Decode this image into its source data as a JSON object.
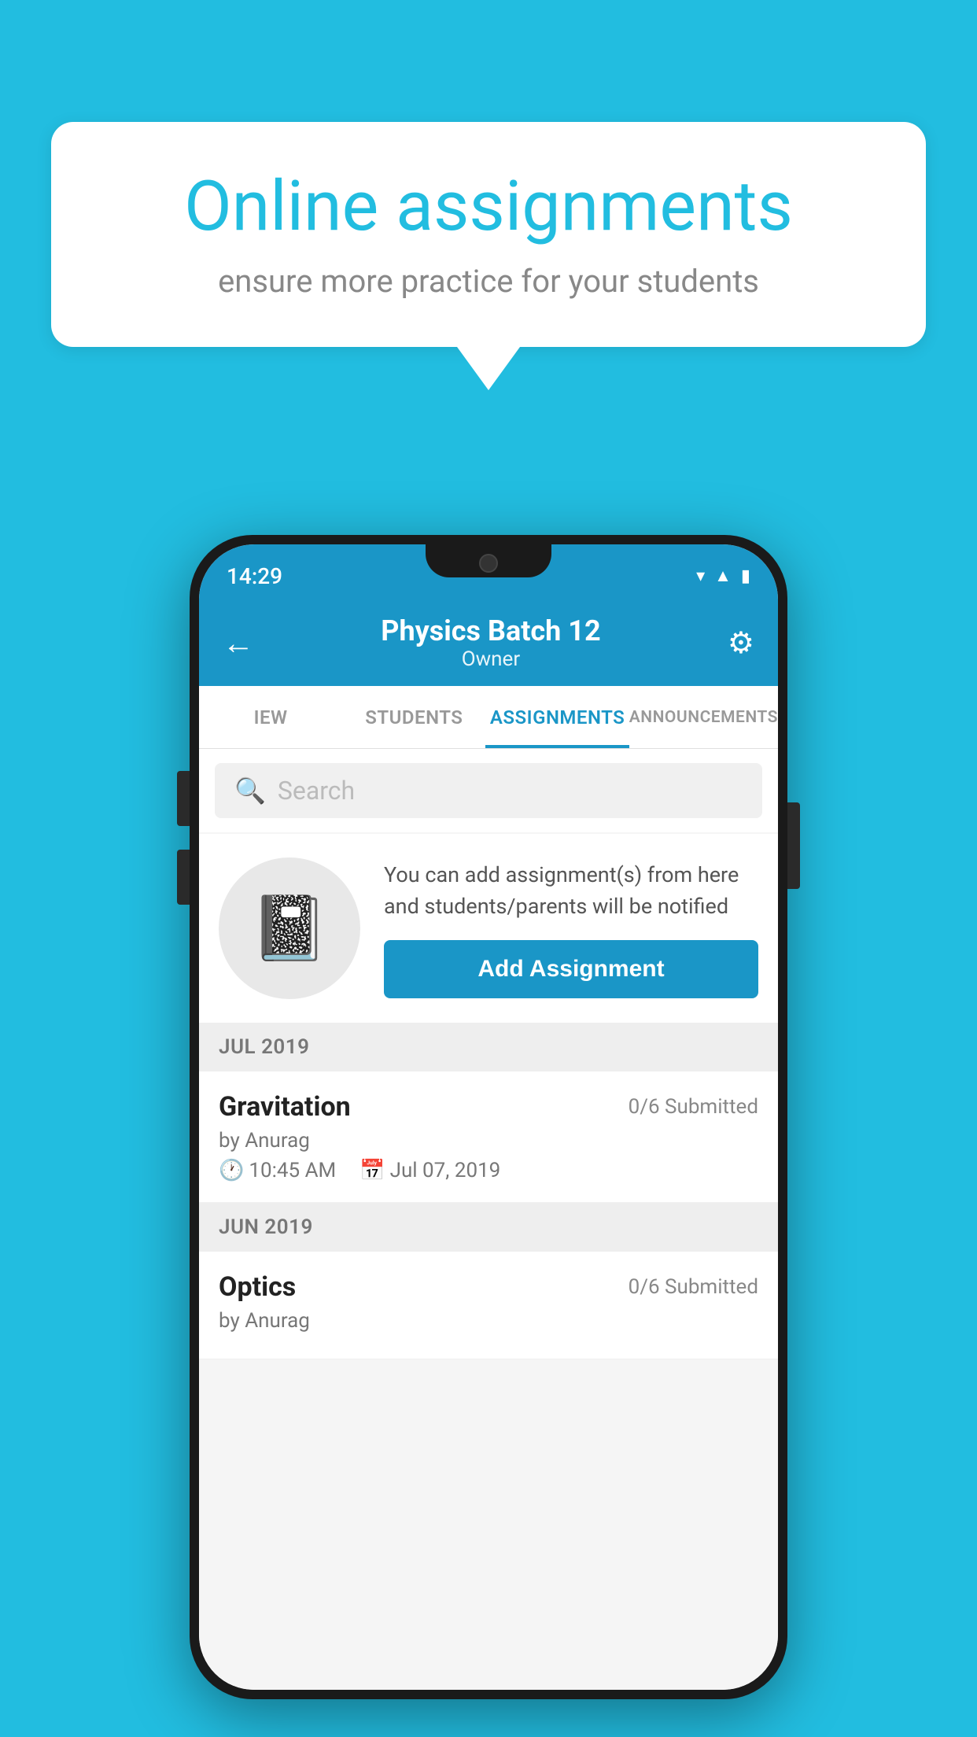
{
  "background_color": "#22bde0",
  "speech_bubble": {
    "title": "Online assignments",
    "subtitle": "ensure more practice for your students"
  },
  "phone": {
    "status_bar": {
      "time": "14:29",
      "icons": [
        "wifi",
        "signal",
        "battery"
      ]
    },
    "header": {
      "title": "Physics Batch 12",
      "subtitle": "Owner",
      "back_label": "←",
      "settings_label": "⚙"
    },
    "tabs": [
      {
        "label": "IEW",
        "active": false
      },
      {
        "label": "STUDENTS",
        "active": false
      },
      {
        "label": "ASSIGNMENTS",
        "active": true
      },
      {
        "label": "ANNOUNCEMENTS",
        "active": false
      }
    ],
    "search": {
      "placeholder": "Search"
    },
    "add_assignment": {
      "description": "You can add assignment(s) from here and students/parents will be notified",
      "button_label": "Add Assignment"
    },
    "sections": [
      {
        "header": "JUL 2019",
        "assignments": [
          {
            "title": "Gravitation",
            "submitted": "0/6 Submitted",
            "by": "by Anurag",
            "time": "10:45 AM",
            "date": "Jul 07, 2019"
          }
        ]
      },
      {
        "header": "JUN 2019",
        "assignments": [
          {
            "title": "Optics",
            "submitted": "0/6 Submitted",
            "by": "by Anurag",
            "time": "",
            "date": ""
          }
        ]
      }
    ]
  }
}
